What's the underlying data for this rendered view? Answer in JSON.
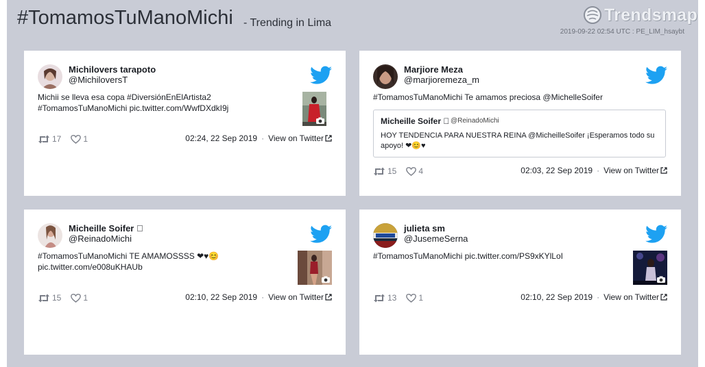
{
  "header": {
    "hashtag": "#TomamosTuManoMichi",
    "subtitle": "- Trending in Lima",
    "brand": "Trendsmap",
    "timestamp": "2019-09-22 02:54 UTC : PE_LIM_hsaybt"
  },
  "colors": {
    "twitter": "#1da1f2",
    "background": "#c9ccd6",
    "card": "#ffffff"
  },
  "tweets": [
    {
      "name": "Michilovers tarapoto",
      "handle": "@MichiloversT",
      "text_line1": "Michii se lleva esa copa #DiversiónEnElArtista2",
      "text_line2": "#TomamosTuManoMichi pic.twitter.com/WwfDXdkI9j",
      "retweets": "17",
      "likes": "1",
      "time": "02:24, 22 Sep 2019",
      "view": "View on Twitter",
      "icon": "twitter-bird-icon"
    },
    {
      "name": "Marjiore Meza",
      "handle": "@marjioremeza_m",
      "text_line1": "#TomamosTuManoMichi Te amamos preciosa @MichelleSoifer",
      "quote_name": "Micheille Soifer \u0000",
      "quote_handle": "@ReinadoMichi",
      "quote_text": "HOY TENDENCIA PARA NUESTRA REINA @MicheilleSoifer ¡Esperamos todo su apoyo! ❤😊♥",
      "retweets": "15",
      "likes": "4",
      "time": "02:03, 22 Sep 2019",
      "view": "View on Twitter",
      "icon": "twitter-bird-icon"
    },
    {
      "name": "Micheille Soifer \u0000",
      "handle": "@ReinadoMichi",
      "text_line1": "#TomamosTuManoMichi TE AMAMOSSSS ❤♥😊",
      "text_line2": "pic.twitter.com/e008uKHAUb",
      "retweets": "15",
      "likes": "1",
      "time": "02:10, 22 Sep 2019",
      "view": "View on Twitter",
      "icon": "twitter-bird-icon"
    },
    {
      "name": "julieta sm",
      "handle": "@JusemeSerna",
      "text_line1": "#TomamosTuManoMichi pic.twitter.com/PS9xKYlLoI",
      "retweets": "13",
      "likes": "1",
      "time": "02:10, 22 Sep 2019",
      "view": "View on Twitter",
      "icon": "twitter-bird-icon"
    }
  ]
}
